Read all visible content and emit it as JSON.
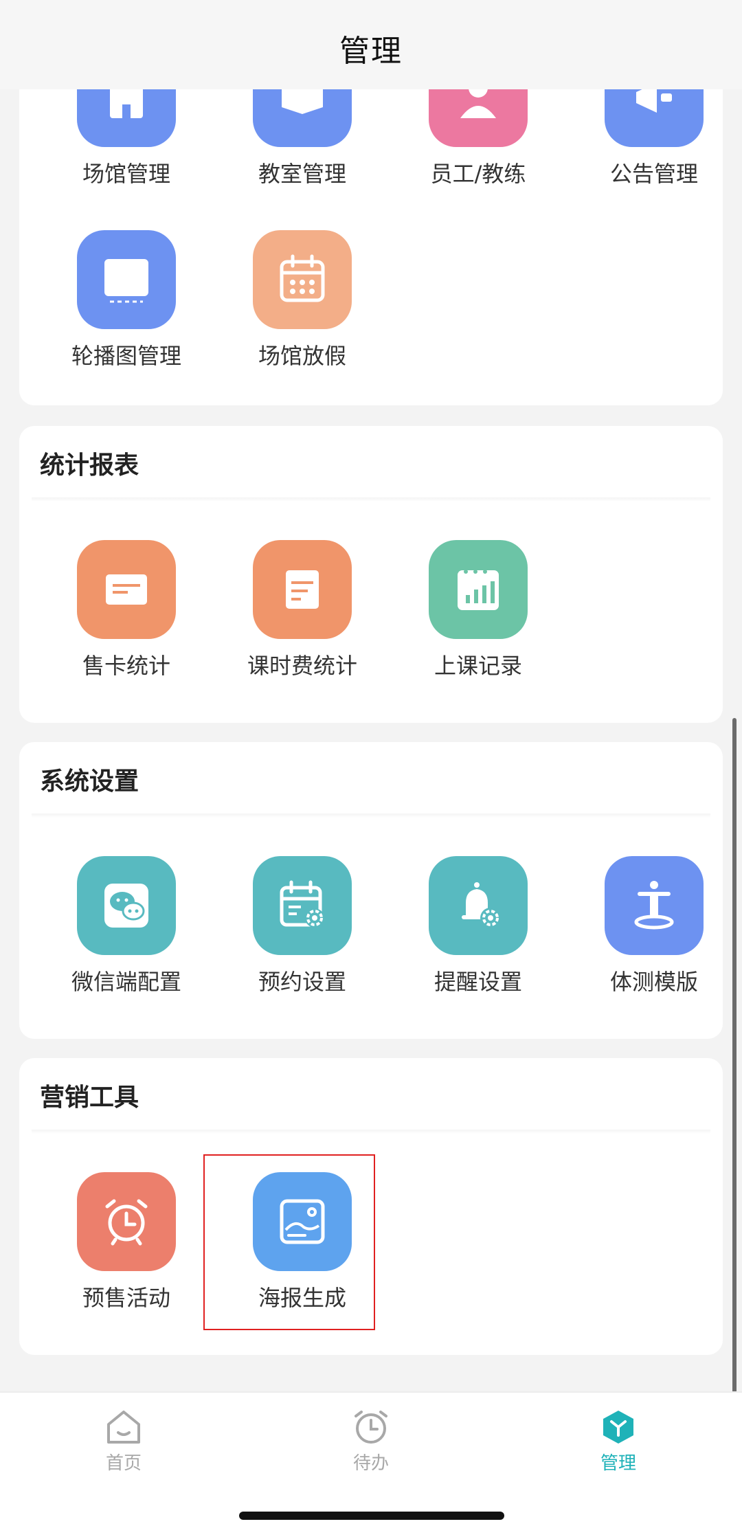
{
  "header": {
    "title": "管理"
  },
  "venue_section": {
    "items": [
      {
        "label": "场馆管理",
        "icon": "building-icon",
        "color": "#6d92f1"
      },
      {
        "label": "教室管理",
        "icon": "classroom-icon",
        "color": "#6d92f1"
      },
      {
        "label": "员工/教练",
        "icon": "staff-icon",
        "color": "#ec78a0"
      },
      {
        "label": "公告管理",
        "icon": "announcement-icon",
        "color": "#6d92f1"
      },
      {
        "label": "轮播图管理",
        "icon": "monitor-icon",
        "color": "#6d92f1"
      },
      {
        "label": "场馆放假",
        "icon": "calendar-icon",
        "color": "#f3ae88"
      }
    ]
  },
  "stats_section": {
    "title": "统计报表",
    "items": [
      {
        "label": "售卡统计",
        "icon": "card-icon",
        "color": "#f0956a"
      },
      {
        "label": "课时费统计",
        "icon": "document-icon",
        "color": "#f0956a"
      },
      {
        "label": "上课记录",
        "icon": "bar-chart-icon",
        "color": "#6cc4a6"
      }
    ]
  },
  "settings_section": {
    "title": "系统设置",
    "items": [
      {
        "label": "微信端配置",
        "icon": "wechat-icon",
        "color": "#58bac0"
      },
      {
        "label": "预约设置",
        "icon": "calendar-gear-icon",
        "color": "#58bac0"
      },
      {
        "label": "提醒设置",
        "icon": "bell-gear-icon",
        "color": "#58bac0"
      },
      {
        "label": "体测模版",
        "icon": "body-test-icon",
        "color": "#6d92f1"
      }
    ]
  },
  "marketing_section": {
    "title": "营销工具",
    "items": [
      {
        "label": "预售活动",
        "icon": "alarm-clock-icon",
        "color": "#ec7f6c"
      },
      {
        "label": "海报生成",
        "icon": "poster-image-icon",
        "color": "#5ea3ee"
      }
    ]
  },
  "tabbar": {
    "home_label": "首页",
    "todo_label": "待办",
    "manage_label": "管理",
    "active_color": "#1fb2b8",
    "inactive_color": "#a8a8a8"
  }
}
